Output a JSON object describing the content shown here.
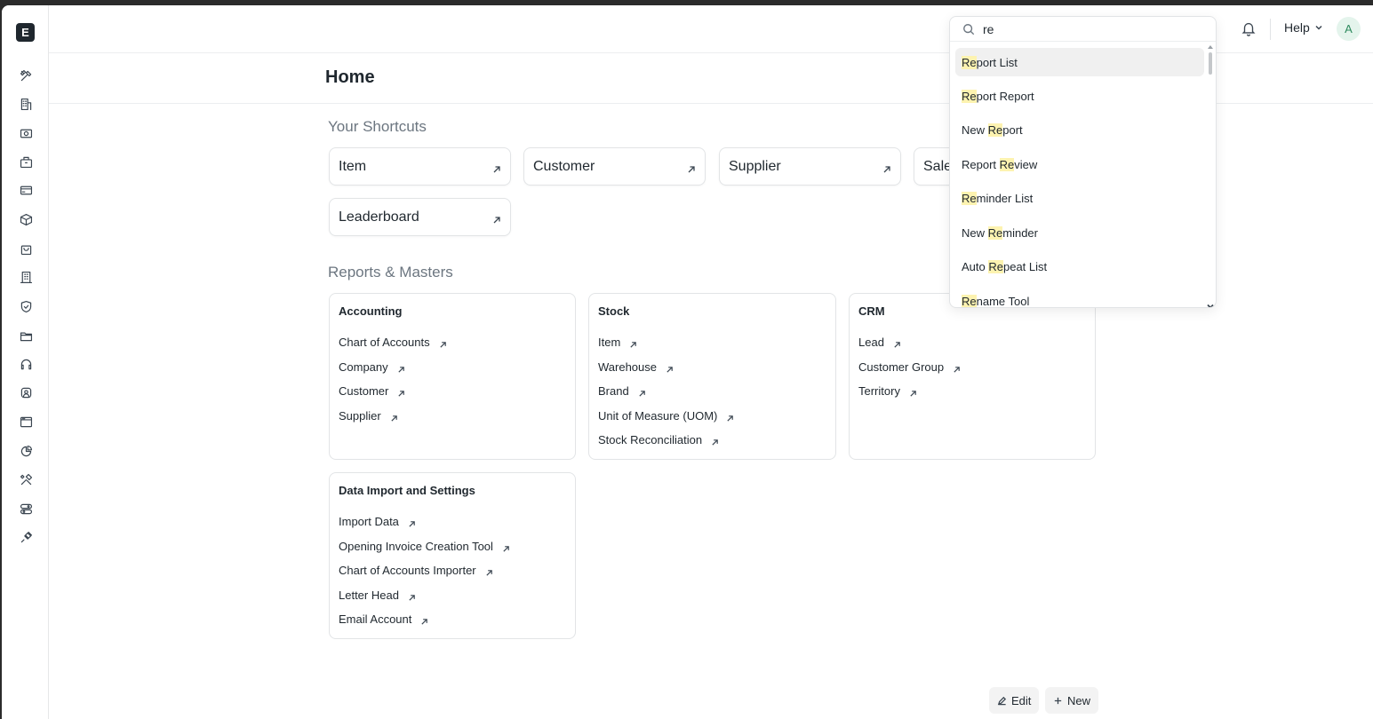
{
  "app": {
    "logo_letter": "E"
  },
  "sidebar": {
    "icons": [
      "tools-icon",
      "building-icon",
      "money-icon",
      "briefcase-icon",
      "card-icon",
      "box-icon",
      "bag-icon",
      "office-icon",
      "shield-icon",
      "folder-icon",
      "headset-icon",
      "users-icon",
      "window-icon",
      "pie-chart-icon",
      "build-icon",
      "toggle-icon",
      "integration-icon"
    ]
  },
  "navbar": {
    "help_label": "Help",
    "avatar_initial": "A"
  },
  "page": {
    "title": "Home"
  },
  "shortcuts": {
    "title": "Your Shortcuts",
    "items": [
      "Item",
      "Customer",
      "Supplier",
      "Sales",
      "Leaderboard"
    ]
  },
  "reports": {
    "title": "Reports & Masters",
    "cards": [
      {
        "title": "Accounting",
        "links": [
          "Chart of Accounts",
          "Company",
          "Customer",
          "Supplier"
        ]
      },
      {
        "title": "Stock",
        "links": [
          "Item",
          "Warehouse",
          "Brand",
          "Unit of Measure (UOM)",
          "Stock Reconciliation"
        ]
      },
      {
        "title": "CRM",
        "links": [
          "Lead",
          "Customer Group",
          "Territory"
        ]
      },
      {
        "title": "Data Import and Settings",
        "links": [
          "Import Data",
          "Opening Invoice Creation Tool",
          "Chart of Accounts Importer",
          "Letter Head",
          "Email Account"
        ]
      }
    ]
  },
  "buttons": {
    "edit": "Edit",
    "new": "New"
  },
  "search": {
    "query": "re",
    "results": [
      {
        "pre": "",
        "hl": "Re",
        "post": "port List"
      },
      {
        "pre": "",
        "hl": "Re",
        "post": "port Report"
      },
      {
        "pre": "New ",
        "hl": "Re",
        "post": "port"
      },
      {
        "pre": "Report ",
        "hl": "Re",
        "post": "view"
      },
      {
        "pre": "",
        "hl": "Re",
        "post": "minder List"
      },
      {
        "pre": "New ",
        "hl": "Re",
        "post": "minder"
      },
      {
        "pre": "Auto ",
        "hl": "Re",
        "post": "peat List"
      },
      {
        "pre": "",
        "hl": "Re",
        "post": "name Tool"
      }
    ]
  }
}
